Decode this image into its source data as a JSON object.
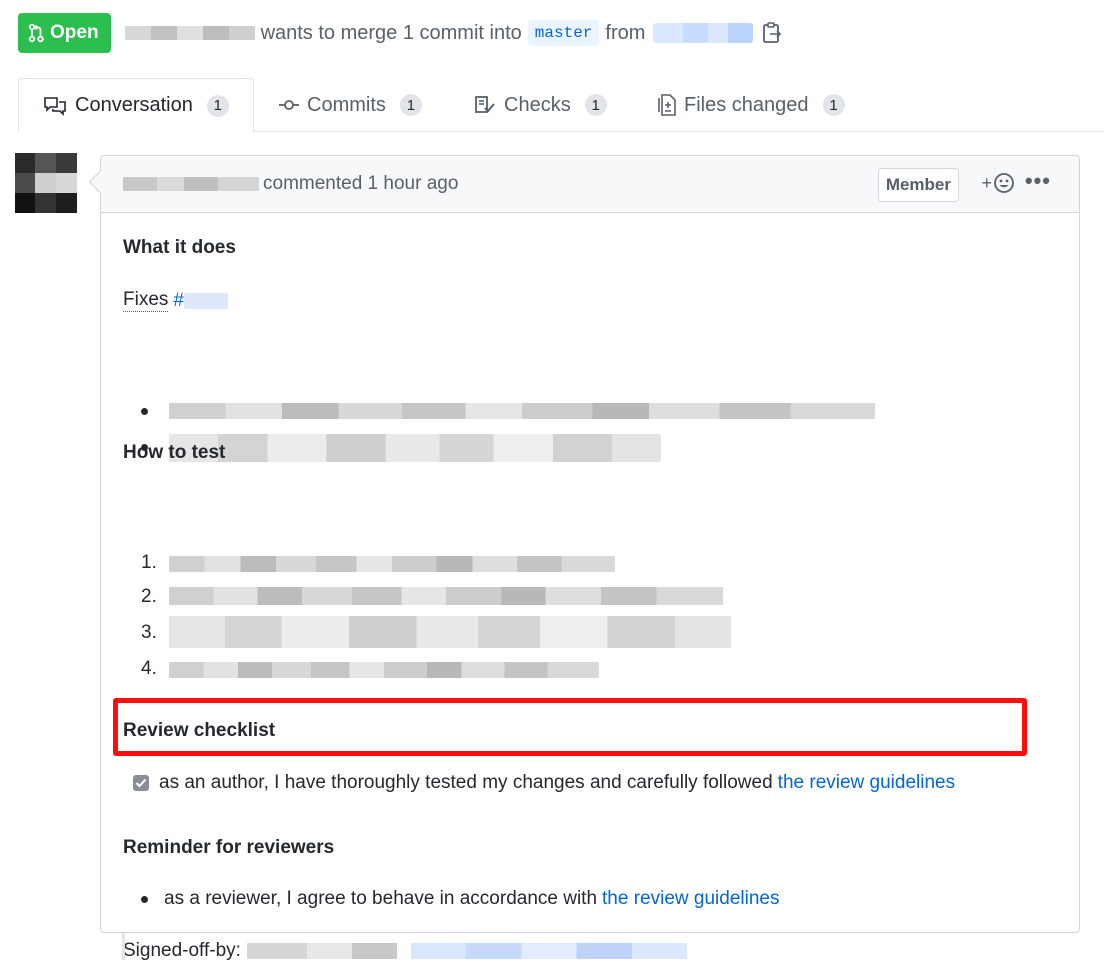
{
  "header": {
    "state_label": "Open",
    "merge_text": "wants to merge 1 commit into",
    "base_branch": "master",
    "from_text": "from"
  },
  "tabs": [
    {
      "label": "Conversation",
      "count": "1",
      "icon": "comment-discussion-icon"
    },
    {
      "label": "Commits",
      "count": "1",
      "icon": "git-commit-icon"
    },
    {
      "label": "Checks",
      "count": "1",
      "icon": "checklist-icon"
    },
    {
      "label": "Files changed",
      "count": "1",
      "icon": "diff-icon"
    }
  ],
  "comment": {
    "action_text": "commented 1 hour ago",
    "badge": "Member",
    "reaction_label": "+",
    "more_label": "•••"
  },
  "body": {
    "h_what": "What it does",
    "fixes_label": "Fixes",
    "fixes_ref": "#",
    "h_test": "How to test",
    "steps": [
      "1.",
      "2.",
      "3.",
      "4."
    ],
    "h_review": "Review checklist",
    "checklist_text": "as an author, I have thoroughly tested my changes and carefully followed",
    "checklist_link": "the review guidelines",
    "h_reminder": "Reminder for reviewers",
    "reminder_text": "as a reviewer, I agree to behave in accordance with",
    "reminder_link": "the review guidelines",
    "signed_label": "Signed-off-by:"
  },
  "colors": {
    "open_green": "#2cbe4e",
    "link_blue": "#0366d6",
    "highlight_red": "#fd0d0d"
  }
}
